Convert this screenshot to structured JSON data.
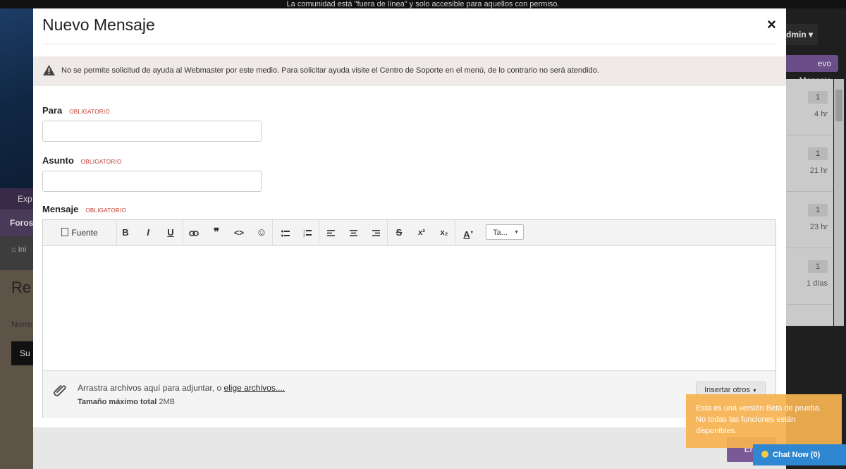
{
  "background": {
    "banner": "La comunidad está \"fuera de línea\" y solo accesible para aquellos con permiso.",
    "admin_label": "dmin",
    "new_message_label": "evo Mensaje",
    "tab_label": "Exp",
    "foros_label": "Foros",
    "breadcrumb": "Ini",
    "heading": "Re",
    "normal_label": "Norm",
    "sub_label": "Su",
    "notifications": [
      {
        "badge": "1",
        "time": "4 hr"
      },
      {
        "badge": "1",
        "time": "21 hr"
      },
      {
        "badge": "1",
        "time": "23 hr"
      },
      {
        "badge": "1",
        "time": "1 días"
      }
    ]
  },
  "modal": {
    "title": "Nuevo Mensaje",
    "close": "×",
    "warning": "No se permite solicitud de ayuda al Webmaster por este medio. Para solicitar ayuda visite el Centro de Soporte en el menú, de lo contrario no será atendido.",
    "fields": {
      "to_label": "Para",
      "subject_label": "Asunto",
      "message_label": "Mensaje",
      "required": "OBLIGATORIO",
      "to_value": "",
      "subject_value": ""
    },
    "toolbar": {
      "html_source": "Fuente HTML",
      "bold": "B",
      "italic": "I",
      "underline": "U",
      "quote": "❞",
      "code": "<>",
      "emoji": "☺",
      "strike": "S",
      "sup": "x²",
      "sub": "x₂",
      "font_color": "A",
      "font_size": "Ta..."
    },
    "attachments": {
      "drop_text": "Arrastra archivos aquí para adjuntar, o ",
      "choose_link": "elige archivos....",
      "max_label": "Tamaño máximo total",
      "max_value": "2MB",
      "insert_other": "Insertar otros"
    }
  },
  "send_label": "Env",
  "beta_notice": "Esta es una versión Beta de prueba. No todas las funciones están disponibles.",
  "chat": {
    "label": "Chat Now",
    "count": "(0)"
  },
  "colors": {
    "accent": "#7a5a96",
    "warning_bg": "#efe9e7",
    "required": "#c0392b",
    "chat": "#2f87d1",
    "beta": "#f6b250"
  }
}
